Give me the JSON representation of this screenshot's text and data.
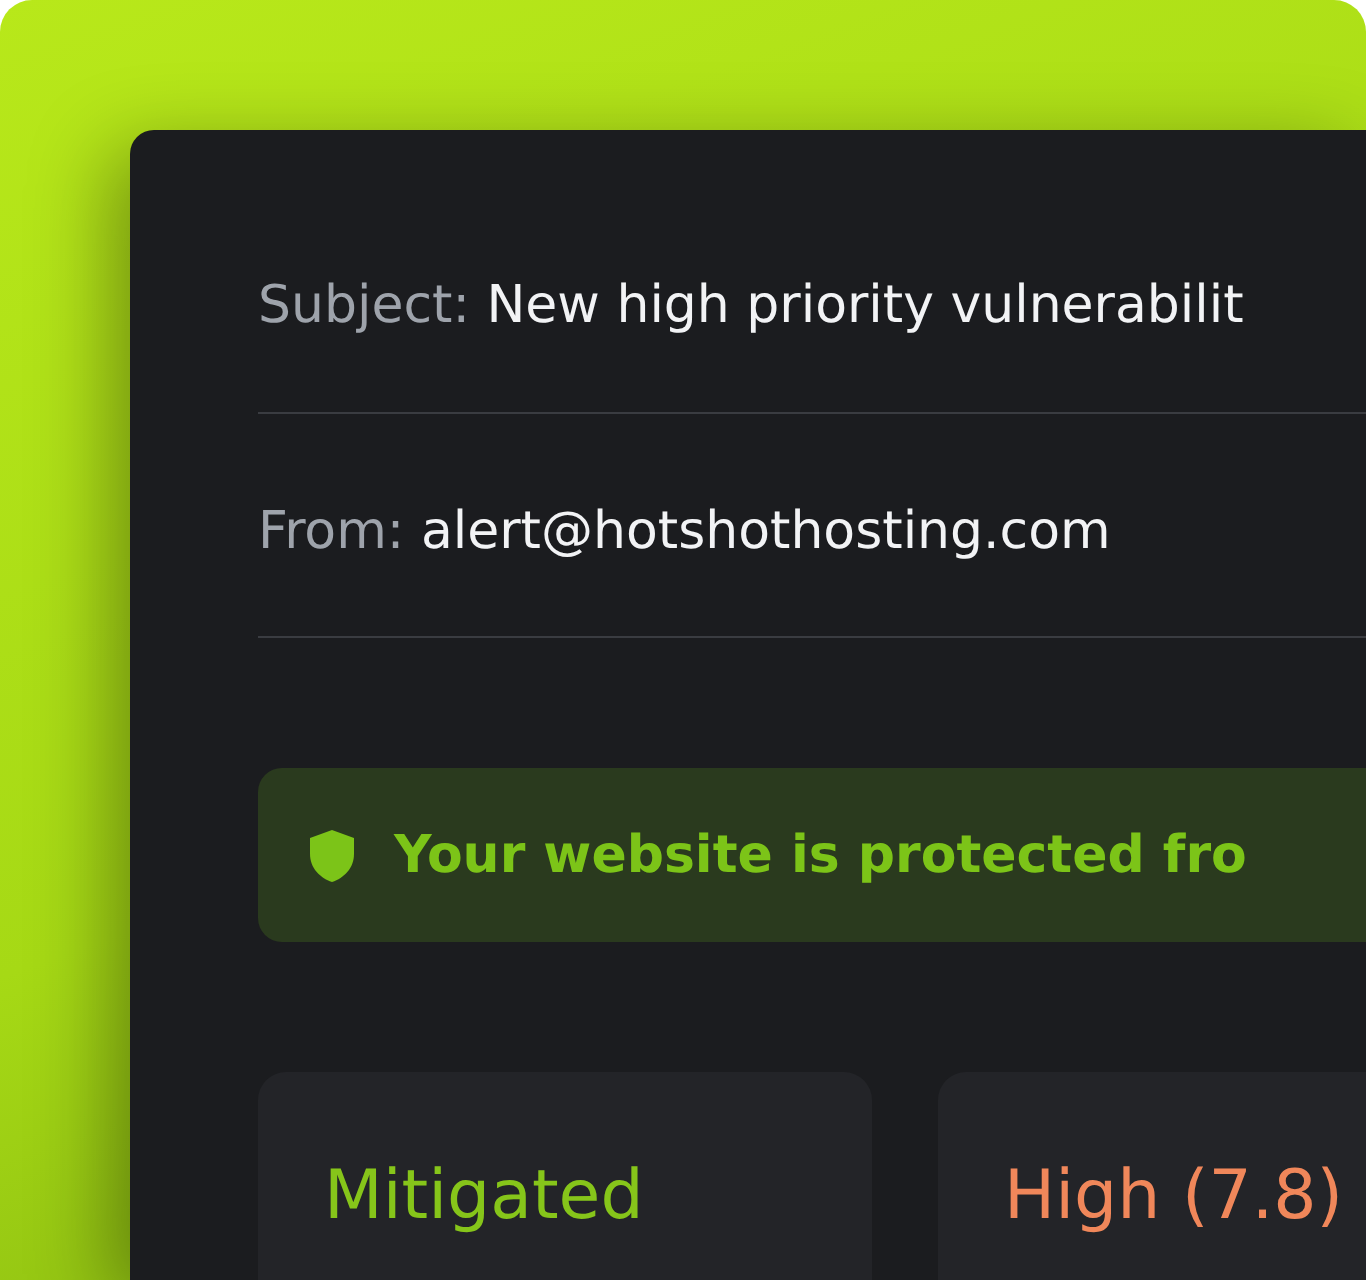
{
  "email": {
    "fields": [
      {
        "label": "Subject:",
        "value": "New high priority vulnerabilit"
      },
      {
        "label": "From:",
        "value": "alert@hotshothosting.com"
      }
    ],
    "banner": {
      "text": "Your website is protected fro"
    },
    "cards": [
      {
        "value": "Mitigated",
        "color": "#86c51a"
      },
      {
        "value": "High (7.8)",
        "color": "#f0875a"
      }
    ]
  }
}
